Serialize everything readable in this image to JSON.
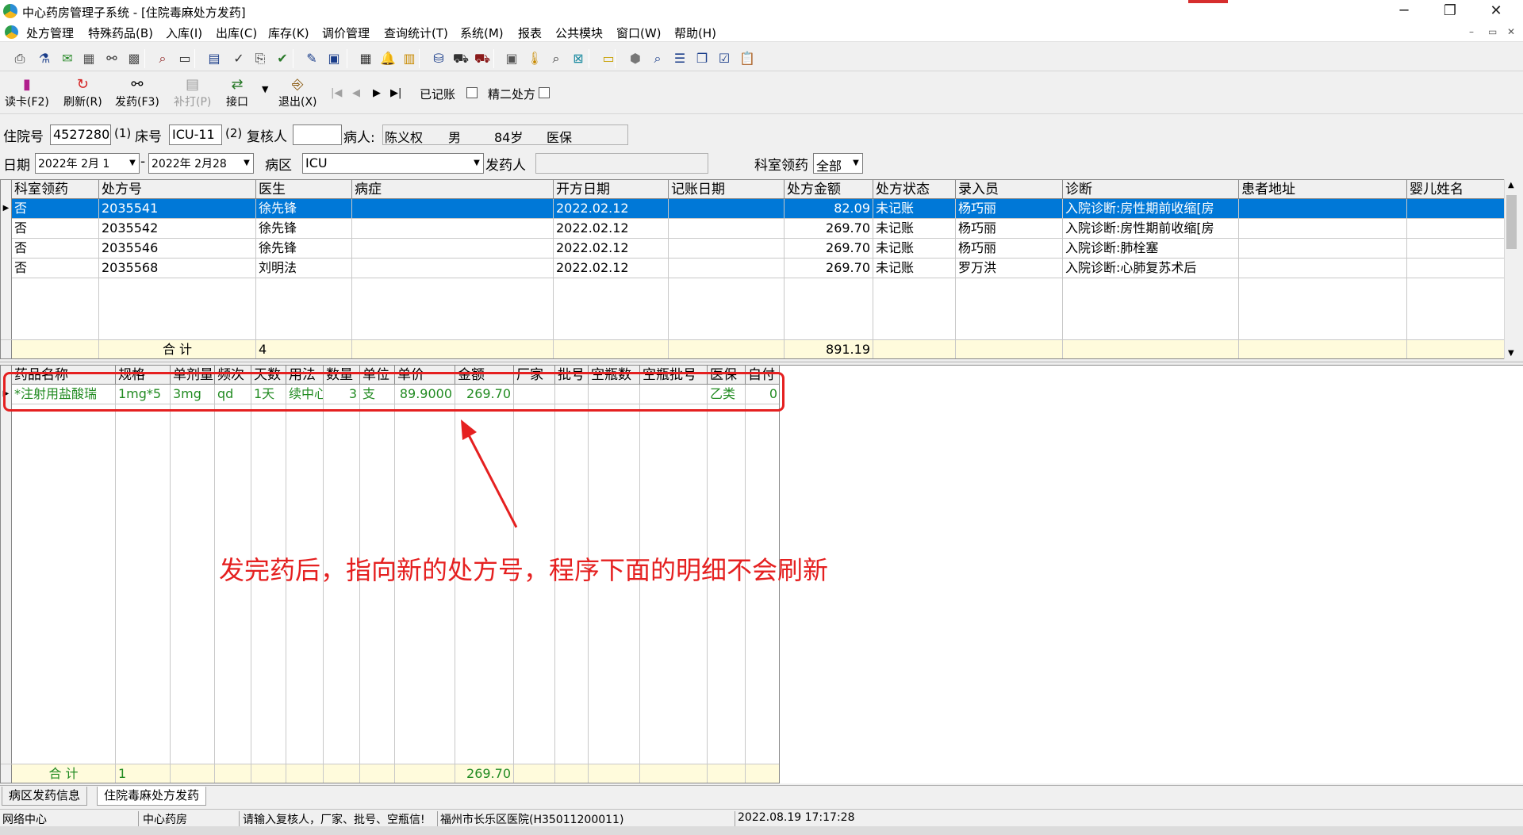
{
  "window": {
    "title": "中心药房管理子系统 - [住院毒麻处方发药]",
    "minimize": "─",
    "restore": "❐",
    "close": "✕"
  },
  "menu": [
    "处方管理",
    "特殊药品(B)",
    "入库(I)",
    "出库(C)",
    "库存(K)",
    "调价管理",
    "查询统计(T)",
    "系统(M)",
    "报表",
    "公共模块",
    "窗口(W)",
    "帮助(H)"
  ],
  "mdi_controls": [
    "–",
    "▭",
    "✕"
  ],
  "toolbar_icons": [
    "print-icon",
    "bottle-icon",
    "check-mail-icon",
    "calculator-icon",
    "binoculars-icon",
    "grid-icon",
    "search-doc-icon",
    "card-icon",
    "book-icon",
    "checkmark-icon",
    "copy-icon",
    "approve-icon",
    "edit-icon",
    "window-icon",
    "calendar-icon",
    "bell-icon",
    "report-icon",
    "bucket-icon",
    "truck-icon",
    "truck2-icon",
    "monitor-icon",
    "thermometer-icon",
    "zoom-icon",
    "close-box-icon",
    "folder-icon",
    "stamp-icon",
    "magnifier-icon",
    "list-icon",
    "cascade-icon",
    "checklist-icon",
    "clipboard-icon"
  ],
  "toolbar2": {
    "read_card": "读卡(F2)",
    "refresh": "刷新(R)",
    "dispense": "发药(F3)",
    "reprint": "补打(P)",
    "interface": "接口",
    "exit": "退出(X)",
    "nav_first": "|◀",
    "nav_prev": "◀",
    "nav_next": "▶",
    "nav_last": "▶|",
    "recorded_label": "已记账",
    "psych2_label": "精二处方"
  },
  "form": {
    "admission_label": "住院号",
    "admission_value": "4527280",
    "bed_prefix": "(1)",
    "bed_label": "床号",
    "bed_value": "ICU-11",
    "reviewer_prefix": "(2)",
    "reviewer_label": "复核人",
    "reviewer_value": "",
    "patient_label": "病人:",
    "patient_name": "陈义权",
    "patient_sex": "男",
    "patient_age": "84岁",
    "patient_insurance": "医保",
    "date_label": "日期",
    "date_from": "2022年 2月 1",
    "date_sep": "-",
    "date_to": "2022年 2月28",
    "ward_label": "病区",
    "ward_value": "ICU",
    "dispenser_label": "发药人",
    "dispenser_value": "",
    "dept_label": "科室领药",
    "dept_value": "全部"
  },
  "prescriptions": {
    "columns": [
      "科室领药",
      "处方号",
      "医生",
      "病症",
      "开方日期",
      "记账日期",
      "处方金额",
      "处方状态",
      "录入员",
      "诊断",
      "患者地址",
      "婴儿姓名"
    ],
    "rows": [
      [
        "否",
        "2035541",
        "徐先锋",
        "",
        "2022.02.12",
        "",
        "82.09",
        "未记账",
        "杨巧丽",
        "入院诊断:房性期前收缩[房",
        "",
        ""
      ],
      [
        "否",
        "2035542",
        "徐先锋",
        "",
        "2022.02.12",
        "",
        "269.70",
        "未记账",
        "杨巧丽",
        "入院诊断:房性期前收缩[房",
        "",
        ""
      ],
      [
        "否",
        "2035546",
        "徐先锋",
        "",
        "2022.02.12",
        "",
        "269.70",
        "未记账",
        "杨巧丽",
        "入院诊断:肺栓塞",
        "",
        ""
      ],
      [
        "否",
        "2035568",
        "刘明法",
        "",
        "2022.02.12",
        "",
        "269.70",
        "未记账",
        "罗万洪",
        "入院诊断:心肺复苏术后",
        "",
        ""
      ]
    ],
    "total_label": "合  计",
    "total_count": "4",
    "total_amount": "891.19"
  },
  "details": {
    "columns": [
      "药品名称",
      "规格",
      "单剂量",
      "频次",
      "天数",
      "用法",
      "数量",
      "单位",
      "单价",
      "金额",
      "厂家",
      "批号",
      "空瓶数",
      "空瓶批号",
      "医保",
      "自付"
    ],
    "rows": [
      [
        "*注射用盐酸瑞",
        "1mg*5",
        "3mg",
        "qd",
        "1天",
        "续中心",
        "3",
        "支",
        "89.9000",
        "269.70",
        "",
        "",
        "",
        "",
        "乙类",
        "0"
      ]
    ],
    "total_label": "合  计",
    "total_count": "1",
    "total_amount": "269.70"
  },
  "annotation": {
    "text": "发完药后，指向新的处方号，程序下面的明细不会刷新",
    "color": "#e52020"
  },
  "tabs": [
    "病区发药信息",
    "住院毒麻处方发药"
  ],
  "status": {
    "network": "网络中心",
    "pharmacy": "中心药房",
    "hint": "请输入复核人，厂家、批号、空瓶信!",
    "hospital": "福州市长乐区医院(H35011200011)",
    "datetime": "2022.08.19 17:17:28"
  },
  "colors": {
    "selection": "#0078d7",
    "total_row": "#fffbdc",
    "detail_text": "#228b22",
    "annotation": "#e52020"
  }
}
